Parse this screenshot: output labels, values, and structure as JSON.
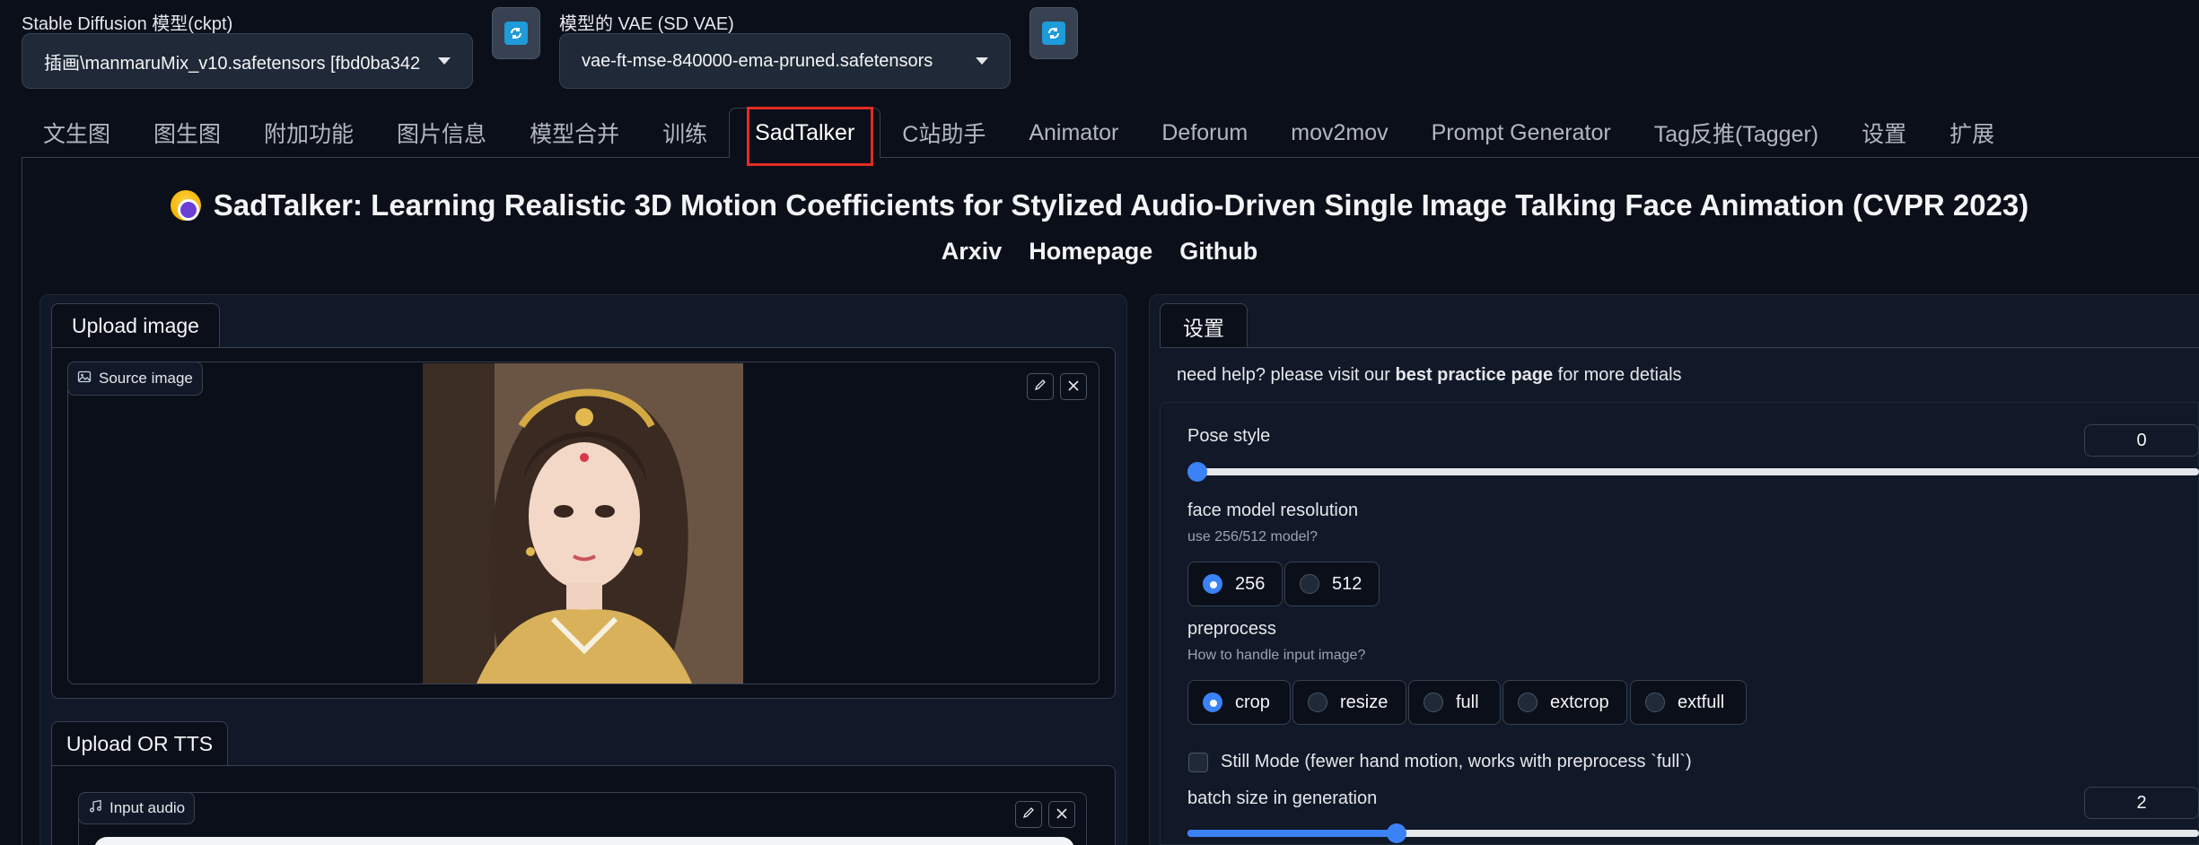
{
  "header": {
    "ckpt_label": "Stable Diffusion 模型(ckpt)",
    "ckpt_value": "插画\\manmaruMix_v10.safetensors [fbd0ba342",
    "vae_label": "模型的 VAE (SD VAE)",
    "vae_value": "vae-ft-mse-840000-ema-pruned.safetensors"
  },
  "tabs": [
    {
      "label": "文生图"
    },
    {
      "label": "图生图"
    },
    {
      "label": "附加功能"
    },
    {
      "label": "图片信息"
    },
    {
      "label": "模型合并"
    },
    {
      "label": "训练"
    },
    {
      "label": "SadTalker",
      "active": true
    },
    {
      "label": "C站助手"
    },
    {
      "label": "Animator"
    },
    {
      "label": "Deforum"
    },
    {
      "label": "mov2mov"
    },
    {
      "label": "Prompt Generator"
    },
    {
      "label": "Tag反推(Tagger)"
    },
    {
      "label": "设置"
    },
    {
      "label": "扩展"
    }
  ],
  "sadtalker": {
    "title": "SadTalker: Learning Realistic 3D Motion Coefficients for Stylized Audio-Driven Single Image Talking Face Animation (CVPR 2023)",
    "links": [
      "Arxiv",
      "Homepage",
      "Github"
    ]
  },
  "left": {
    "upload_image_tab": "Upload image",
    "source_image_label": "Source image",
    "upload_tts_tab": "Upload OR TTS",
    "input_audio_label": "Input audio"
  },
  "settings": {
    "tab": "设置",
    "help_prefix": "need help? please visit our ",
    "help_link": "best practice page",
    "help_suffix": " for more detials",
    "pose_style_label": "Pose style",
    "pose_style_value": "0",
    "face_res_label": "face model resolution",
    "face_res_hint": "use 256/512 model?",
    "face_res_options": [
      "256",
      "512"
    ],
    "face_res_selected": "256",
    "preprocess_label": "preprocess",
    "preprocess_hint": "How to handle input image?",
    "preprocess_options": [
      "crop",
      "resize",
      "full",
      "extcrop",
      "extfull"
    ],
    "preprocess_selected": "crop",
    "still_mode_label": "Still Mode (fewer hand motion, works with preprocess `full`)",
    "still_mode_checked": false,
    "batch_size_label": "batch size in generation",
    "batch_size_value": "2"
  },
  "colors": {
    "accent": "#3b82f6",
    "highlight_box": "#e32c25",
    "background": "#0b0f19"
  }
}
